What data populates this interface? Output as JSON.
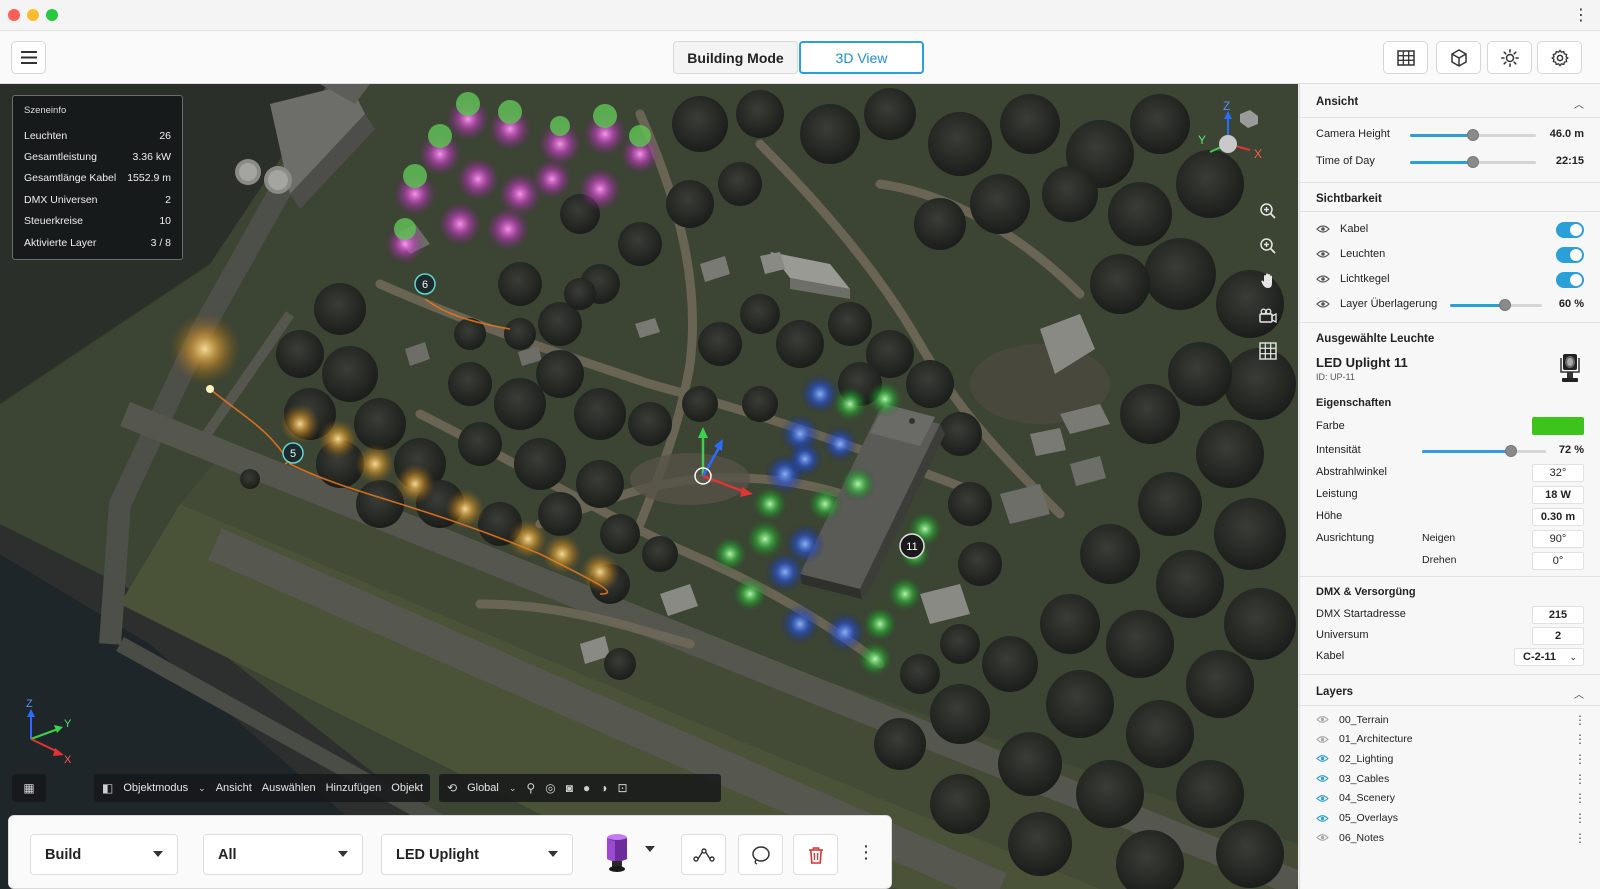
{
  "toolbar": {
    "mode_building": "Building Mode",
    "mode_3d": "3D View"
  },
  "scene_info": {
    "title": "Szeneinfo",
    "rows": [
      {
        "label": "Leuchten",
        "value": "26"
      },
      {
        "label": "Gesamtleistung",
        "value": "3.36 kW"
      },
      {
        "label": "Gesamtlänge Kabel",
        "value": "1552.9 m"
      },
      {
        "label": "DMX Universen",
        "value": "2"
      },
      {
        "label": "Steuerkreise",
        "value": "10"
      },
      {
        "label": "Aktivierte Layer",
        "value": "3 / 8"
      }
    ]
  },
  "gizmo": {
    "z": "Z",
    "y": "Y",
    "x": "X"
  },
  "markers": {
    "m6": "6",
    "m5": "5",
    "m11": "11"
  },
  "strip": {
    "objektmodus": "Objektmodus",
    "ansicht": "Ansicht",
    "auswaehlen": "Auswählen",
    "hinzufuegen": "Hinzufügen",
    "objekt": "Objekt",
    "global": "Global"
  },
  "buildbar": {
    "mode": "Build",
    "filter": "All",
    "fixture": "LED Uplight"
  },
  "panel": {
    "ansicht": {
      "title": "Ansicht",
      "camera_label": "Camera Height",
      "camera_value": "46.0 m",
      "camera_level": 0.5,
      "time_label": "Time of Day",
      "time_value": "22:15",
      "time_level": 0.5
    },
    "sichtbarkeit": {
      "title": "Sichtbarkeit",
      "kabel": "Kabel",
      "leuchten": "Leuchten",
      "lichtkegel": "Lichtkegel",
      "overlay_label": "Layer Überlagerung",
      "overlay_value": "60 %",
      "overlay_level": 0.6
    },
    "selected": {
      "section": "Ausgewählte Leuchte",
      "name": "LED Uplight 11",
      "id": "ID: UP-11"
    },
    "eigenschaften": {
      "title": "Eigenschaften",
      "farbe_label": "Farbe",
      "farbe_color": "#3cc41c",
      "intensitaet_label": "Intensität",
      "intensitaet_value": "72 %",
      "intensitaet_level": 0.72,
      "abstrahl_label": "Abstrahlwinkel",
      "abstrahl_value": "32°",
      "leistung_label": "Leistung",
      "leistung_value": "18 W",
      "hoehe_label": "Höhe",
      "hoehe_value": "0.30 m",
      "ausrichtung_label": "Ausrichtung",
      "neigen_label": "Neigen",
      "neigen_value": "90°",
      "drehen_label": "Drehen",
      "drehen_value": "0°"
    },
    "dmx": {
      "title": "DMX & Versorgüng",
      "start_label": "DMX Startadresse",
      "start_value": "215",
      "universum_label": "Universum",
      "universum_value": "2",
      "kabel_label": "Kabel",
      "kabel_value": "C-2-11"
    },
    "layers": {
      "title": "Layers",
      "items": [
        {
          "name": "00_Terrain",
          "visible": false
        },
        {
          "name": "01_Architecture",
          "visible": false
        },
        {
          "name": "02_Lighting",
          "visible": true
        },
        {
          "name": "03_Cables",
          "visible": true
        },
        {
          "name": "04_Scenery",
          "visible": true
        },
        {
          "name": "05_Overlays",
          "visible": true
        },
        {
          "name": "06_Notes",
          "visible": false
        }
      ]
    }
  },
  "colors": {
    "accent": "#2a9fd8",
    "light_magenta": "#ff5ae8",
    "light_amber": "#ffb43a",
    "light_blue": "#2a6bff",
    "light_green": "#44ff5a",
    "cable": "#e8741f"
  }
}
